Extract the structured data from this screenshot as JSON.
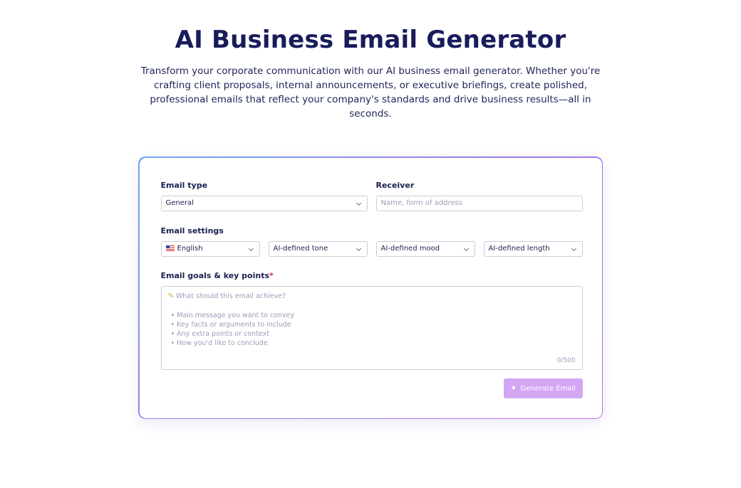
{
  "hero": {
    "title": "AI Business Email Generator",
    "subtitle": "Transform your corporate communication with our AI business email generator. Whether you're crafting client proposals, internal announcements, or executive briefings, create polished, professional emails that reflect your company's standards and drive business results—all in seconds."
  },
  "form": {
    "email_type": {
      "label": "Email type",
      "value": "General"
    },
    "receiver": {
      "label": "Receiver",
      "placeholder": "Name, form of address"
    },
    "settings": {
      "label": "Email settings",
      "language": "English",
      "tone": "AI-defined tone",
      "mood": "AI-defined mood",
      "length": "AI-defined length"
    },
    "goals": {
      "label": "Email goals & key points",
      "required_mark": "*",
      "placeholder_head": "What should this email achieve?",
      "bullets": [
        "• Main message you want to convey",
        "• Key facts or arguments to include",
        "• Any extra points or context",
        "• How you'd like to conclude"
      ],
      "counter": "0/500"
    },
    "generate_label": "Generate Email"
  },
  "icons": {
    "flag": "us-flag-icon",
    "pencil": "pencil-icon",
    "sparkle": "sparkle-icon",
    "chevron": "chevron-down-icon"
  },
  "colors": {
    "title": "#181c5b",
    "button": "#d3a6f4",
    "border_gradient_start": "#6fa6f2",
    "border_gradient_end": "#c771e6",
    "required": "#e0264a"
  }
}
